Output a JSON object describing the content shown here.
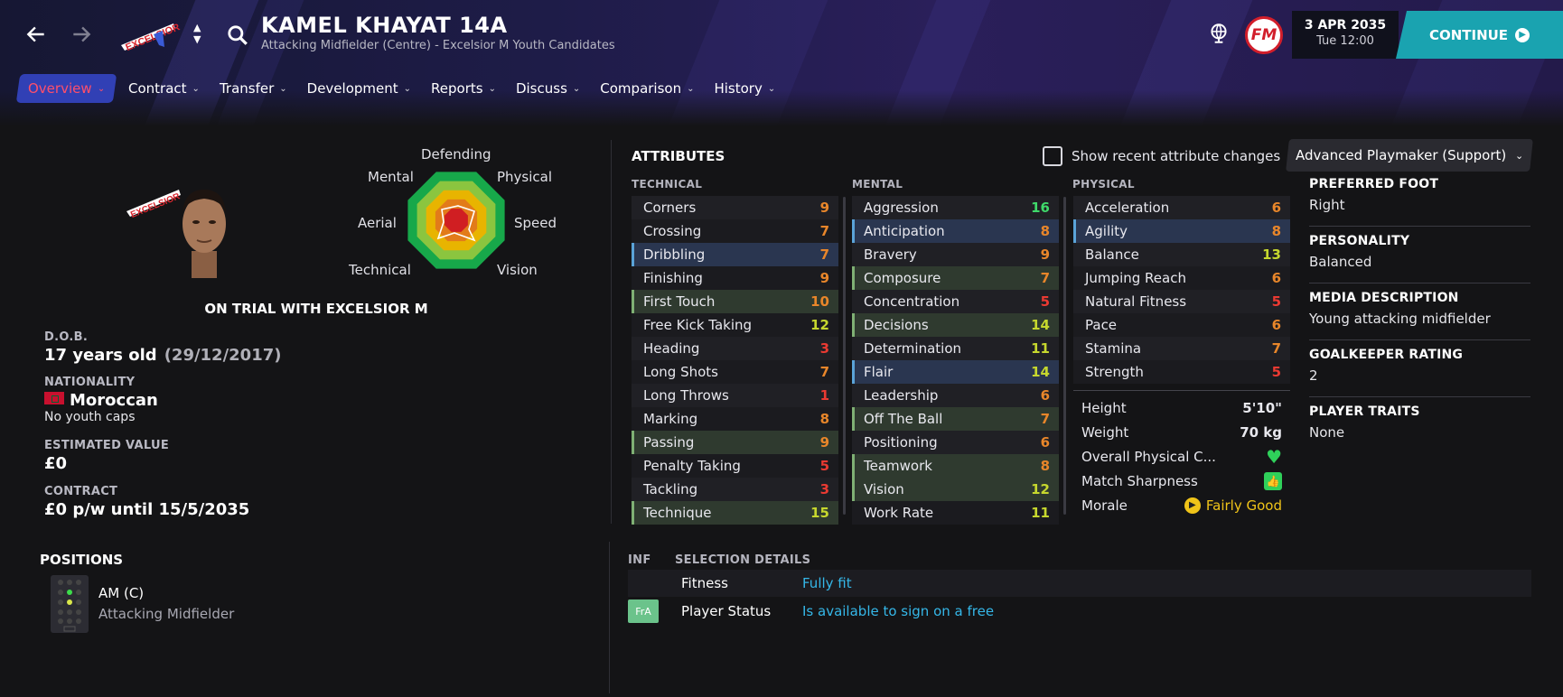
{
  "header": {
    "player_name": "KAMEL KHAYAT 14A",
    "subtitle": "Attacking Midfielder (Centre) - Excelsior M Youth Candidates",
    "club_crest_text": "EXCELSIOR",
    "fm_logo_text": "FM",
    "date": "3 APR 2035",
    "time": "Tue 12:00",
    "continue_label": "CONTINUE"
  },
  "tabs": [
    {
      "label": "Overview",
      "active": true
    },
    {
      "label": "Contract"
    },
    {
      "label": "Transfer"
    },
    {
      "label": "Development"
    },
    {
      "label": "Reports"
    },
    {
      "label": "Discuss"
    },
    {
      "label": "Comparison"
    },
    {
      "label": "History"
    }
  ],
  "radar": {
    "labels": {
      "top": "Defending",
      "top_left": "Mental",
      "top_right": "Physical",
      "left": "Aerial",
      "right": "Speed",
      "bottom_left": "Technical",
      "bottom_right": "Vision"
    },
    "colors": [
      "#17a84a",
      "#8bc53f",
      "#e8b400",
      "#e27b1a",
      "#d01e22"
    ]
  },
  "trial_text": "ON TRIAL WITH EXCELSIOR M",
  "info": {
    "dob_label": "D.O.B.",
    "dob_age": "17 years old",
    "dob_date": "(29/12/2017)",
    "nationality_label": "NATIONALITY",
    "nationality": "Moroccan",
    "youth_caps": "No youth caps",
    "value_label": "ESTIMATED VALUE",
    "value": "£0",
    "contract_label": "CONTRACT",
    "contract": "£0 p/w until 15/5/2035"
  },
  "positions": {
    "title": "POSITIONS",
    "code": "AM (C)",
    "name": "Attacking Midfielder"
  },
  "attributes": {
    "title": "ATTRIBUTES",
    "show_changes_label": "Show recent attribute changes",
    "role": "Advanced Playmaker (Support)",
    "technical_label": "TECHNICAL",
    "mental_label": "MENTAL",
    "physical_label": "PHYSICAL",
    "technical": [
      {
        "name": "Corners",
        "value": "9",
        "color": "#e8862a",
        "hl": ""
      },
      {
        "name": "Crossing",
        "value": "7",
        "color": "#e8862a",
        "hl": ""
      },
      {
        "name": "Dribbling",
        "value": "7",
        "color": "#e8862a",
        "hl": "blue"
      },
      {
        "name": "Finishing",
        "value": "9",
        "color": "#e8862a",
        "hl": ""
      },
      {
        "name": "First Touch",
        "value": "10",
        "color": "#e8862a",
        "hl": "green"
      },
      {
        "name": "Free Kick Taking",
        "value": "12",
        "color": "#c6d72e",
        "hl": ""
      },
      {
        "name": "Heading",
        "value": "3",
        "color": "#ea3a32",
        "hl": ""
      },
      {
        "name": "Long Shots",
        "value": "7",
        "color": "#e8862a",
        "hl": ""
      },
      {
        "name": "Long Throws",
        "value": "1",
        "color": "#ea3a32",
        "hl": ""
      },
      {
        "name": "Marking",
        "value": "8",
        "color": "#e8862a",
        "hl": ""
      },
      {
        "name": "Passing",
        "value": "9",
        "color": "#e8862a",
        "hl": "green"
      },
      {
        "name": "Penalty Taking",
        "value": "5",
        "color": "#ea3a32",
        "hl": ""
      },
      {
        "name": "Tackling",
        "value": "3",
        "color": "#ea3a32",
        "hl": ""
      },
      {
        "name": "Technique",
        "value": "15",
        "color": "#c6d72e",
        "hl": "green"
      }
    ],
    "mental": [
      {
        "name": "Aggression",
        "value": "16",
        "color": "#3fd96a",
        "hl": ""
      },
      {
        "name": "Anticipation",
        "value": "8",
        "color": "#e8862a",
        "hl": "blue"
      },
      {
        "name": "Bravery",
        "value": "9",
        "color": "#e8862a",
        "hl": ""
      },
      {
        "name": "Composure",
        "value": "7",
        "color": "#e8862a",
        "hl": "green"
      },
      {
        "name": "Concentration",
        "value": "5",
        "color": "#ea3a32",
        "hl": ""
      },
      {
        "name": "Decisions",
        "value": "14",
        "color": "#c6d72e",
        "hl": "green"
      },
      {
        "name": "Determination",
        "value": "11",
        "color": "#c6d72e",
        "hl": ""
      },
      {
        "name": "Flair",
        "value": "14",
        "color": "#c6d72e",
        "hl": "blue"
      },
      {
        "name": "Leadership",
        "value": "6",
        "color": "#e8862a",
        "hl": ""
      },
      {
        "name": "Off The Ball",
        "value": "7",
        "color": "#e8862a",
        "hl": "green"
      },
      {
        "name": "Positioning",
        "value": "6",
        "color": "#e8862a",
        "hl": ""
      },
      {
        "name": "Teamwork",
        "value": "8",
        "color": "#e8862a",
        "hl": "green"
      },
      {
        "name": "Vision",
        "value": "12",
        "color": "#c6d72e",
        "hl": "green"
      },
      {
        "name": "Work Rate",
        "value": "11",
        "color": "#c6d72e",
        "hl": ""
      }
    ],
    "physical": [
      {
        "name": "Acceleration",
        "value": "6",
        "color": "#e8862a",
        "hl": ""
      },
      {
        "name": "Agility",
        "value": "8",
        "color": "#e8862a",
        "hl": "blue"
      },
      {
        "name": "Balance",
        "value": "13",
        "color": "#c6d72e",
        "hl": ""
      },
      {
        "name": "Jumping Reach",
        "value": "6",
        "color": "#e8862a",
        "hl": ""
      },
      {
        "name": "Natural Fitness",
        "value": "5",
        "color": "#ea3a32",
        "hl": ""
      },
      {
        "name": "Pace",
        "value": "6",
        "color": "#e8862a",
        "hl": ""
      },
      {
        "name": "Stamina",
        "value": "7",
        "color": "#e8862a",
        "hl": ""
      },
      {
        "name": "Strength",
        "value": "5",
        "color": "#ea3a32",
        "hl": ""
      }
    ],
    "body": {
      "height_label": "Height",
      "height": "5'10\"",
      "weight_label": "Weight",
      "weight": "70 kg",
      "condition_label": "Overall Physical C...",
      "sharpness_label": "Match Sharpness",
      "morale_label": "Morale",
      "morale": "Fairly Good"
    }
  },
  "right_panel": [
    {
      "label": "PREFERRED FOOT",
      "value": "Right"
    },
    {
      "label": "PERSONALITY",
      "value": "Balanced"
    },
    {
      "label": "MEDIA DESCRIPTION",
      "value": "Young attacking midfielder"
    },
    {
      "label": "GOALKEEPER RATING",
      "value": "2"
    },
    {
      "label": "PLAYER TRAITS",
      "value": "None"
    }
  ],
  "selection": {
    "inf_header": "INF",
    "details_header": "SELECTION DETAILS",
    "rows": [
      {
        "badge": "",
        "label": "Fitness",
        "value": "Fully fit"
      },
      {
        "badge": "FrA",
        "label": "Player Status",
        "value": "Is available to sign on a free"
      }
    ]
  }
}
